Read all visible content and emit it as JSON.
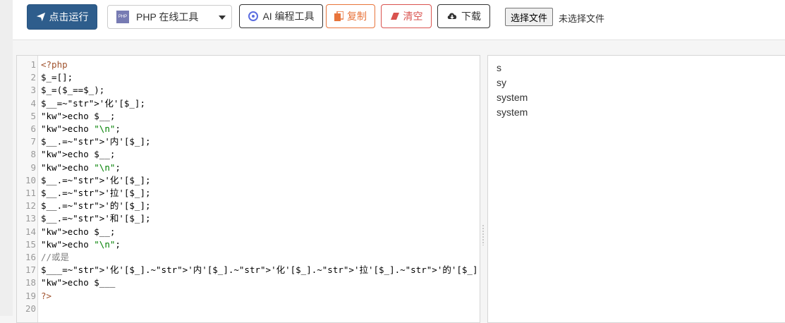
{
  "toolbar": {
    "run_label": "点击运行",
    "language_select": "PHP 在线工具",
    "php_badge": "PHP",
    "ai_label": "AI 编程工具",
    "copy_label": "复制",
    "clear_label": "清空",
    "download_label": "下载",
    "file_button": "选择文件",
    "file_status": "未选择文件"
  },
  "colors": {
    "run": "#2e5d8c",
    "copy": "#e8743b",
    "clear": "#d9534f"
  },
  "editor": {
    "lines": [
      {
        "n": "1",
        "c": "<?php"
      },
      {
        "n": "2",
        "c": "$_=[];"
      },
      {
        "n": "3",
        "c": "$_=($_==$_);"
      },
      {
        "n": "4",
        "c": "$__=~'化'[$_];"
      },
      {
        "n": "5",
        "c": "echo $__;"
      },
      {
        "n": "6",
        "c": "echo \"\\n\";"
      },
      {
        "n": "7",
        "c": "$__.=~'内'[$_];"
      },
      {
        "n": "8",
        "c": "echo $__;"
      },
      {
        "n": "9",
        "c": "echo \"\\n\";"
      },
      {
        "n": "10",
        "c": "$__.=~'化'[$_];"
      },
      {
        "n": "11",
        "c": "$__.=~'拉'[$_];"
      },
      {
        "n": "12",
        "c": "$__.=~'的'[$_];"
      },
      {
        "n": "13",
        "c": "$__.=~'和'[$_];"
      },
      {
        "n": "14",
        "c": "echo $__;"
      },
      {
        "n": "15",
        "c": "echo \"\\n\";"
      },
      {
        "n": "16",
        "c": "//或是"
      },
      {
        "n": "17",
        "c": "$___=~'化'[$_].~'内'[$_].~'化'[$_].~'拉'[$_].~'的'[$_].~'和'[$_];"
      },
      {
        "n": "18",
        "c": "echo $___"
      },
      {
        "n": "19",
        "c": "?>"
      },
      {
        "n": "20",
        "c": ""
      }
    ]
  },
  "output": {
    "lines": [
      "s",
      "sy",
      "system",
      "system"
    ]
  }
}
